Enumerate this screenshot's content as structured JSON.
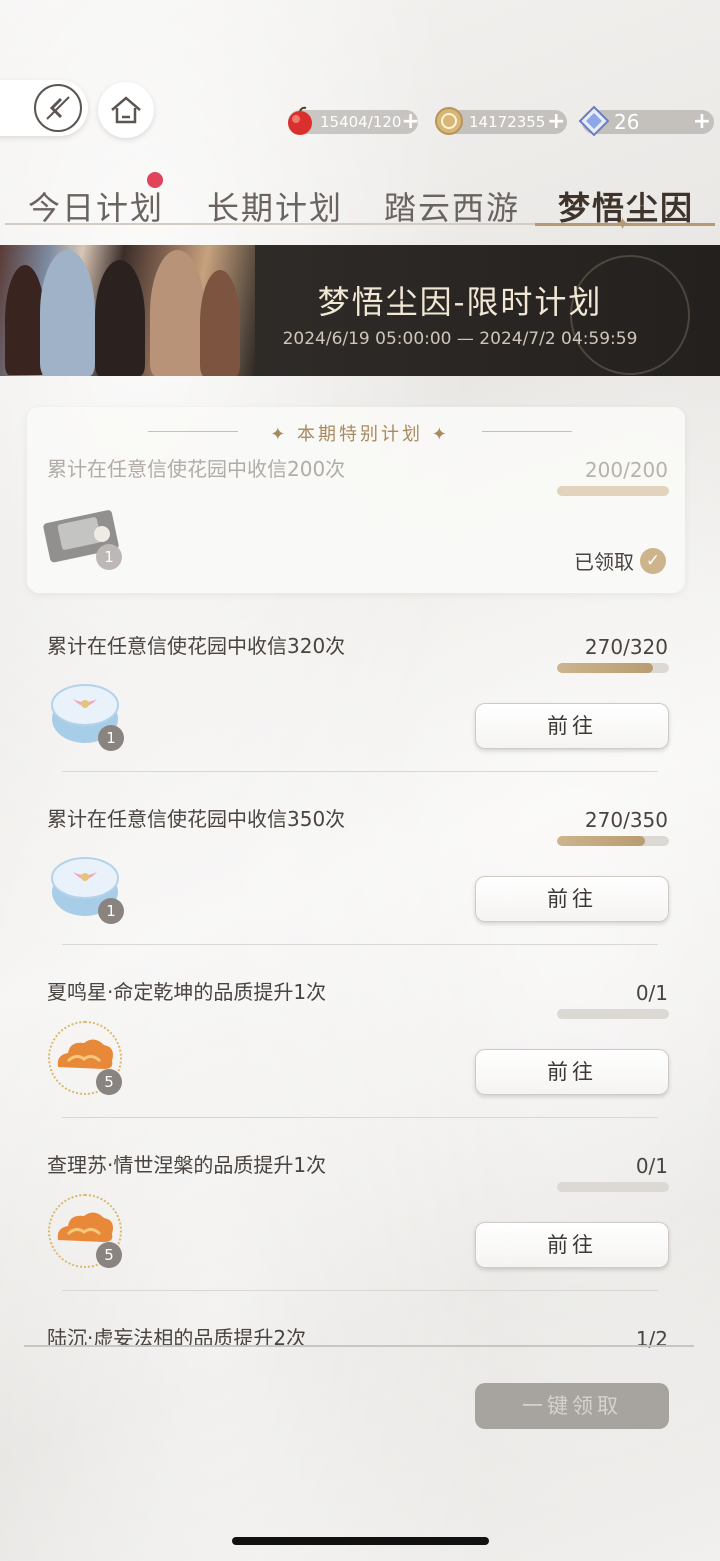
{
  "currencies": [
    {
      "icon": "apple-stamina-icon",
      "value": "15404/120"
    },
    {
      "icon": "gold-coin-icon",
      "value": "14172355"
    },
    {
      "icon": "diamond-icon",
      "value": "26"
    }
  ],
  "tabs": [
    {
      "label": "今日计划",
      "active": false,
      "badge": true
    },
    {
      "label": "长期计划",
      "active": false
    },
    {
      "label": "踏云西游",
      "active": false
    },
    {
      "label": "梦悟尘因",
      "active": true
    }
  ],
  "banner": {
    "title": "梦悟尘因-限时计划",
    "date_range": "2024/6/19 05:00:00 — 2024/7/2 04:59:59"
  },
  "special": {
    "header": "本期特别计划",
    "task": {
      "title": "累计在任意信使花园中收信200次",
      "progress": "200/200",
      "progress_fraction": 1.0,
      "reward_icon": "gift-box-dark-icon",
      "reward_count": "1",
      "status": "已领取"
    }
  },
  "tasks": [
    {
      "title": "累计在任意信使花园中收信320次",
      "progress": "270/320",
      "progress_fraction": 0.84,
      "reward_icon": "gift-box-blue-icon",
      "reward_count": "1",
      "action": "前往"
    },
    {
      "title": "累计在任意信使花园中收信350次",
      "progress": "270/350",
      "progress_fraction": 0.77,
      "reward_icon": "gift-box-blue-icon",
      "reward_count": "1",
      "action": "前往"
    },
    {
      "title": "夏鸣星·命定乾坤的品质提升1次",
      "progress": "0/1",
      "progress_fraction": 0,
      "reward_icon": "golden-cloud-icon",
      "reward_count": "5",
      "action": "前往"
    },
    {
      "title": "查理苏·情世涅槃的品质提升1次",
      "progress": "0/1",
      "progress_fraction": 0,
      "reward_icon": "golden-cloud-icon",
      "reward_count": "5",
      "action": "前往"
    },
    {
      "title": "陆沉·虚妄法相的品质提升2次",
      "progress": "1/2"
    }
  ],
  "claim_all_label": "一键领取"
}
